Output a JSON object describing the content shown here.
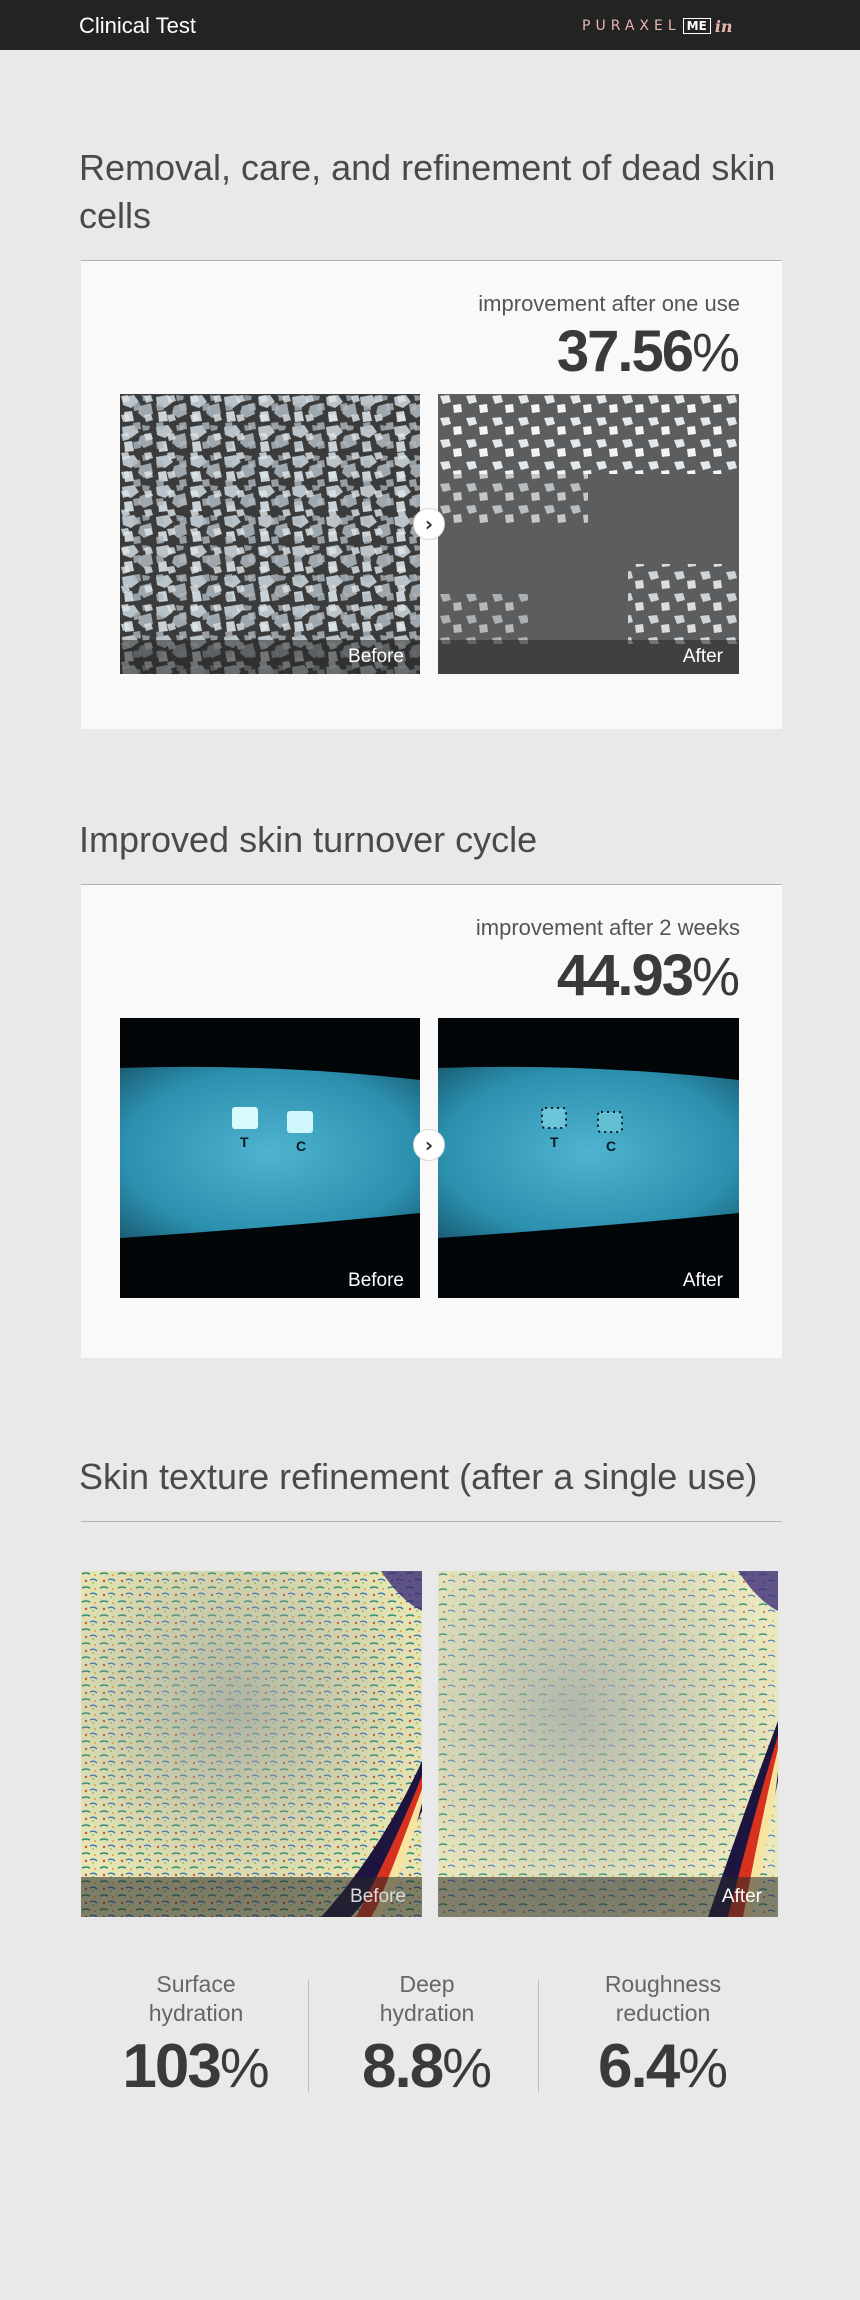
{
  "header": {
    "title": "Clinical Test",
    "logo": {
      "main": "PURAXEL",
      "boxed": "ME",
      "script": "in"
    }
  },
  "sections": [
    {
      "title": "Removal, care, and refinement of dead skin cells",
      "improvement_label": "improvement after one use",
      "value": "37.56",
      "unit": "%",
      "before_label": "Before",
      "after_label": "After"
    },
    {
      "title": "Improved skin turnover cycle",
      "improvement_label": "improvement after 2 weeks",
      "value": "44.93",
      "unit": "%",
      "before_label": "Before",
      "after_label": "After",
      "marker_labels": [
        "T",
        "C"
      ]
    },
    {
      "title": "Skin texture refinement (after a single use)",
      "before_label": "Before",
      "after_label": "After"
    }
  ],
  "stats": [
    {
      "label_line1": "Surface",
      "label_line2": "hydration",
      "value": "103",
      "unit": "%"
    },
    {
      "label_line1": "Deep",
      "label_line2": "hydration",
      "value": "8.8",
      "unit": "%"
    },
    {
      "label_line1": "Roughness",
      "label_line2": "reduction",
      "value": "6.4",
      "unit": "%"
    }
  ],
  "icons": {
    "compare_arrow": "chevron-right-icon"
  },
  "colors": {
    "header_bg": "#232323",
    "page_bg": "#e9e9e9",
    "card_bg": "#f9f9f9",
    "brand_accent": "#e8b6ae",
    "uv_blue": "#2fa3c3"
  }
}
